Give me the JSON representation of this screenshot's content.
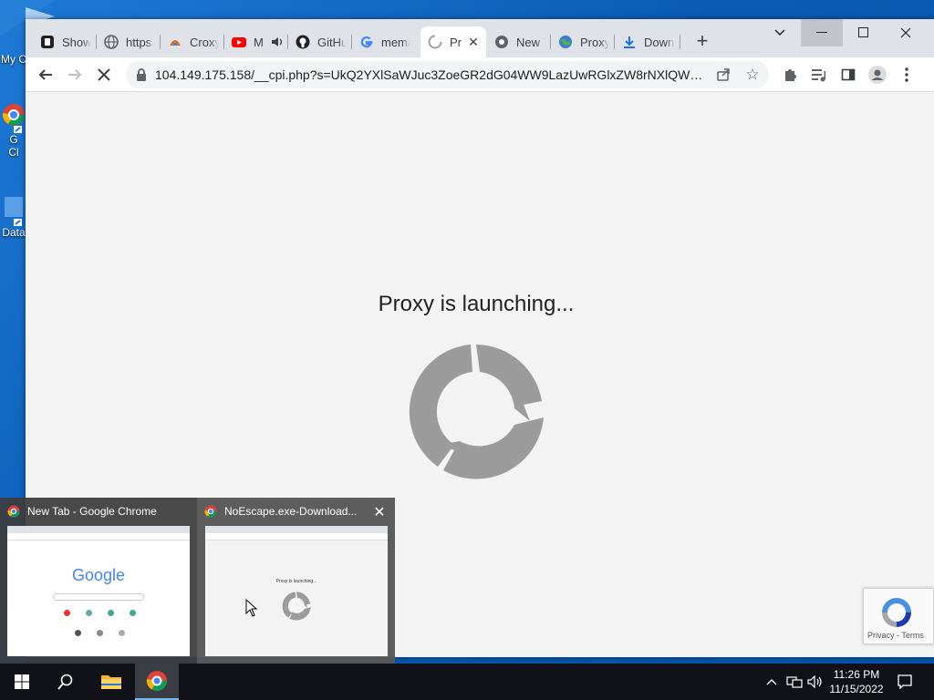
{
  "desktop": {
    "icons": [
      {
        "label": "My C"
      },
      {
        "label": "G"
      },
      {
        "label": "Cl"
      },
      {
        "label": "Data"
      }
    ]
  },
  "browser": {
    "tabs": [
      {
        "title": "Show",
        "icon": "blogger-icon"
      },
      {
        "title": "https",
        "icon": "globe-icon"
      },
      {
        "title": "Croxy",
        "icon": "croxy-icon"
      },
      {
        "title": "M",
        "icon": "youtube-icon",
        "audio": true
      },
      {
        "title": "GitHu",
        "icon": "github-icon"
      },
      {
        "title": "mema",
        "icon": "google-icon"
      },
      {
        "title": "Pr",
        "icon": "loading-icon",
        "active": true
      },
      {
        "title": "New T",
        "icon": "chrome-icon"
      },
      {
        "title": "Proxy",
        "icon": "globe-color-icon"
      },
      {
        "title": "Down",
        "icon": "download-icon"
      }
    ],
    "new_tab_label": "+",
    "window_controls": {
      "minimize": "—",
      "maximize": "☐",
      "close": "✕",
      "tab_search": "⌄"
    },
    "url": "104.149.175.158/__cpi.php?s=UkQ2YXlSaWJuc3ZoeGR2dG04WW9LazUwRGlxZW8rNXlQWWlmN...",
    "page": {
      "message": "Proxy is launching...",
      "recaptcha_links": "Privacy - Terms"
    }
  },
  "thumbnails": [
    {
      "title": "New Tab - Google Chrome",
      "google_word": "Google"
    },
    {
      "title": "NoEscape.exe-Download...",
      "close": "✕",
      "mini_message": "Proxy is launching..."
    }
  ],
  "taskbar": {
    "time": "11:26 PM",
    "date": "11/15/2022"
  },
  "colors": {
    "accent": "#1a73e8",
    "spinner": "#9b9b9b",
    "desktop": "#0b5bb5",
    "taskbar": "#101218"
  }
}
